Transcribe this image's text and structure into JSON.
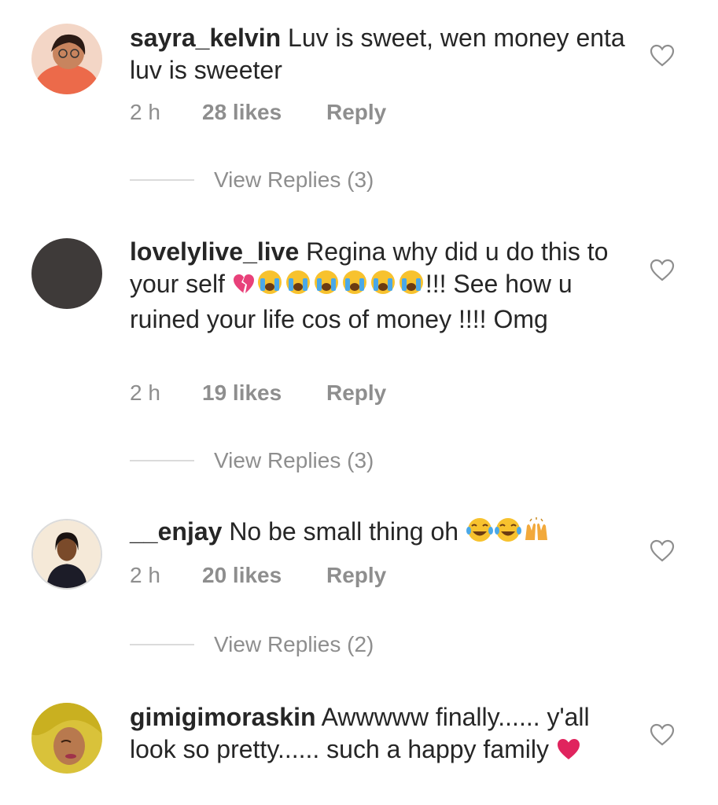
{
  "comments": [
    {
      "username": "sayra_kelvin",
      "text": "Luv is sweet, wen money enta luv is sweeter",
      "text_after_emoji": "",
      "time": "2 h",
      "likes": "28 likes",
      "reply_label": "Reply",
      "view_replies": "View Replies (3)"
    },
    {
      "username": "lovelylive_live",
      "text": "Regina why did u do this to your self",
      "text_after_emoji": "!!! See how u ruined your life cos of money !!!! Omg",
      "time": "2 h",
      "likes": "19 likes",
      "reply_label": "Reply",
      "view_replies": "View Replies (3)"
    },
    {
      "username": "__enjay",
      "text": "No be small thing oh",
      "text_after_emoji": "",
      "time": "2 h",
      "likes": "20 likes",
      "reply_label": "Reply",
      "view_replies": "View Replies (2)"
    },
    {
      "username": "gimigimoraskin",
      "text": "Awwwww finally...... y'all look so pretty...... such a happy family",
      "text_after_emoji": "",
      "time": "",
      "likes": "",
      "reply_label": "",
      "view_replies": ""
    }
  ],
  "icons": {
    "like": "heart-outline-icon",
    "broken_heart": "broken-heart-emoji",
    "crying": "crying-face-emoji",
    "laughing": "tears-of-joy-emoji",
    "raised_hands": "raised-hands-emoji",
    "red_heart": "red-heart-emoji"
  },
  "colors": {
    "text": "#262626",
    "meta": "#8e8e8e",
    "divider": "#dbdbdb",
    "heart_red": "#e0245e"
  }
}
